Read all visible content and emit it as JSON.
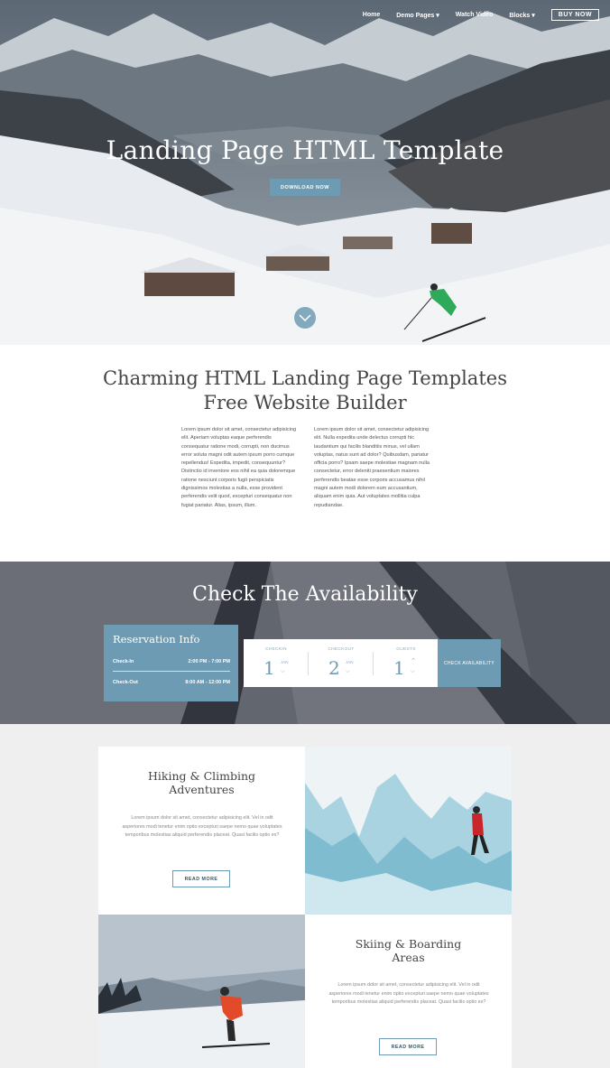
{
  "nav": {
    "home": "Home",
    "demo_pages": "Demo Pages ▾",
    "watch_video": "Watch Video",
    "blocks": "Blocks ▾",
    "buy_now": "BUY NOW"
  },
  "hero": {
    "title": "Landing Page HTML Template",
    "button": "DOWNLOAD NOW"
  },
  "intro": {
    "title_line1": "Charming HTML Landing Page Templates",
    "title_line2": "Free Website Builder",
    "col1": "Lorem ipsum dolor sit amet, consectetur adipisicing elit. Aperiam voluptas eaque perferendis consequatur ratione modi, corrupti, non ducimus error soluta magni odit autem ipsum porro cumque repellendus! Expedita, impedit, consequuntur? Distinctio id inventore eos nihil ea quia doloremque ratione nesciunt corporis fugit perspiciatis dignissimos molestias a nulla, esse provident perferendis velit quod, excepturi consequatur non fugiat pariatur. Alias, ipsum, illum.",
    "col2": "Lorem ipsum dolor sit amet, consectetur adipisicing elit. Nulla expedita unde delectus corrupti hic laudantium qui facilis blanditiis minus, vel ullam voluptas, natus sunt ad dolor? Quibusdam, pariatur officia porro? Ipsam saepe molestiae magnam nulla consectetur, error deleniti praesentium maiores perferendis beatae esse corporis accusamus nihil magni autem modi dolorem eum accusantium, aliquam enim quia. Aut voluptates mollitia culpa repudiandae."
  },
  "availability": {
    "title": "Check The Availability",
    "reservation": {
      "title": "Reservation Info",
      "checkin_label": "Check-In",
      "checkin_time": "2:00 PM - 7:00 PM",
      "checkout_label": "Check-Out",
      "checkout_time": "8:00 AM - 12:00 PM"
    },
    "form": {
      "checkin_label": "CHECKIN",
      "checkin_day": "1",
      "checkin_month": "JAN",
      "checkout_label": "CHECKOUT",
      "checkout_day": "2",
      "checkout_month": "JAN",
      "guests_label": "GUESTS",
      "guests_value": "1"
    },
    "check_button": "CHECK AVAILABILITY"
  },
  "features": [
    {
      "title_line1": "Hiking & Climbing",
      "title_line2": "Adventures",
      "text": "Lorem ipsum dolor sit amet, consectetur adipisicing elit. Vel in odit asperiores modi tenetur enim optio excepturi saepe nemo quae voluptates temporibus molestias aliquid perferendis placeat. Quasi facilis optio ex?",
      "button": "READ MORE"
    },
    {
      "title_line1": "Skiing & Boarding",
      "title_line2": "Areas",
      "text": "Lorem ipsum dolor sit amet, consectetur adipisicing elit. Vel in odit asperiores modi tenetur enim optio excepturi saepe nemo quae voluptates temporibus molestias aliquid perferendis placeat. Quasi facilis optio ex?",
      "button": "READ MORE"
    }
  ],
  "colors": {
    "accent": "#6e9bb4",
    "text": "#444444",
    "bg": "#efefef"
  }
}
